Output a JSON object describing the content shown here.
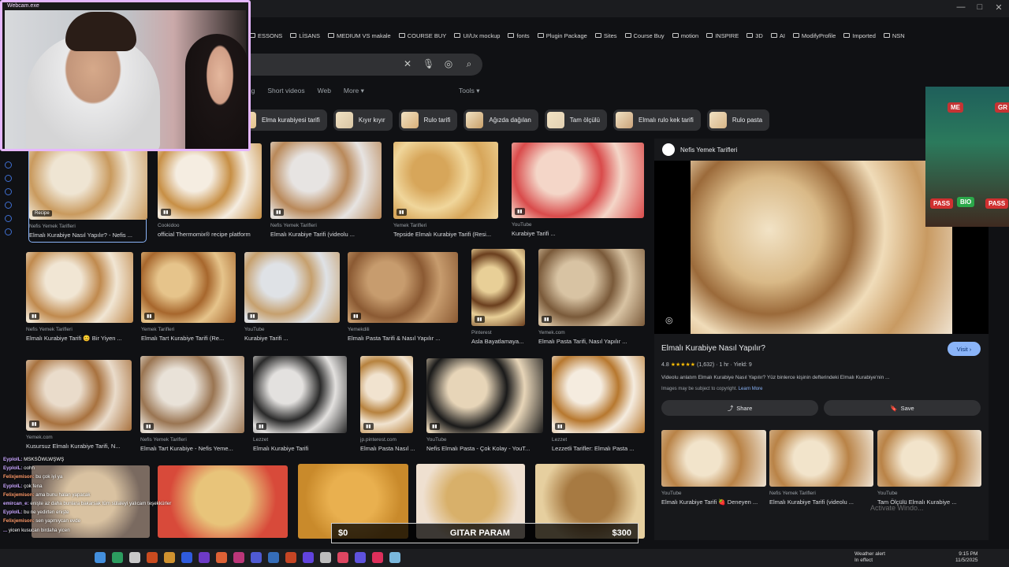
{
  "webcam": {
    "title": "Webcam.exe"
  },
  "window_controls": [
    "—",
    "□",
    "✕"
  ],
  "bookmarks": [
    "ESSONS",
    "LİSANS",
    "MEDIUM VS makale",
    "COURSE BUY",
    "UI/Ux mockup",
    "fonts",
    "Plugin Package",
    "Sites",
    "Course Buy",
    "motion",
    "INSPIRE",
    "3D",
    "AI",
    "ModifyProfile",
    "Imported",
    "NSN"
  ],
  "search": {
    "value": ""
  },
  "tabs": [
    "ing",
    "Short videos",
    "Web",
    "More"
  ],
  "tools_label": "Tools",
  "chips": [
    "Elma kurabiyesi tarifi",
    "Kıyır kıyır",
    "Rulo tarifi",
    "Ağızda dağılan",
    "Tam ölçülü",
    "Elmalı rulo kek tarifi",
    "Rulo pasta"
  ],
  "grid": [
    {
      "src": "Nefis Yemek Tarifleri",
      "title": "Elmalı Kurabiye Nasıl Yapılır? - Nefis ...",
      "badge": "Recipe"
    },
    {
      "src": "Cookidoo",
      "title": "official Thermomix® recipe platform",
      "badge": ""
    },
    {
      "src": "Nefis Yemek Tarifleri",
      "title": "Elmalı Kurabiye Tarifi (videolu ...",
      "badge": ""
    },
    {
      "src": "Yemek Tarifleri",
      "title": "Tepside Elmalı Kurabiye Tarifi (Resi...",
      "badge": ""
    },
    {
      "src": "YouTube",
      "title": "Kurabiye Tarifi ...",
      "badge": ""
    },
    {
      "src": "Nefis Yemek Tarifleri",
      "title": "Elmalı Kurabiye Tarifi 😊 Bir Yiyen ...",
      "badge": ""
    },
    {
      "src": "Yemek Tarifleri",
      "title": "Elmalı Tart Kurabiye Tarifi (Re...",
      "badge": ""
    },
    {
      "src": "YouTube",
      "title": "Kurabiye Tarifi ...",
      "badge": ""
    },
    {
      "src": "Yemekdili",
      "title": "Elmalı Pasta Tarifi & Nasıl Yapılır ...",
      "badge": ""
    },
    {
      "src": "Pinterest",
      "title": "Asla Bayatlamaya...",
      "badge": ""
    },
    {
      "src": "Yemek.com",
      "title": "Elmalı Pasta Tarifi, Nasıl Yapılır ...",
      "badge": ""
    },
    {
      "src": "Yemek.com",
      "title": "Kusursuz Elmalı Kurabiye Tarifi, N...",
      "badge": ""
    },
    {
      "src": "Nefis Yemek Tarifleri",
      "title": "Elmalı Tart Kurabiye - Nefis Yeme...",
      "badge": ""
    },
    {
      "src": "Lezzet",
      "title": "Elmalı Kurabiye Tarifi",
      "badge": ""
    },
    {
      "src": "jp.pinterest.com",
      "title": "Elmalı Pasta Nasıl ...",
      "badge": ""
    },
    {
      "src": "YouTube",
      "title": "Nefis Elmalı Pasta - Çok Kolay - YouT...",
      "badge": ""
    },
    {
      "src": "Lezzet",
      "title": "Lezzetli Tarifler: Elmalı Pasta ...",
      "badge": ""
    }
  ],
  "panel": {
    "source": "Nefis Yemek Tarifleri",
    "title": "Elmalı Kurabiye Nasıl Yapılır?",
    "visit_label": "Visit",
    "rating_value": "4.8",
    "stars": "★★★★★",
    "rating_count": "(1,632)",
    "time": "1 hr",
    "yield": "Yield: 9",
    "description": "Videolu anlatım Elmalı Kurabiye Nasıl Yapılır? Yüz binlerce kişinin defterindeki Elmalı Kurabiye'nin ...",
    "note": "Images may be subject to copyright.",
    "learn_more": "Learn More",
    "share_label": "Share",
    "save_label": "Save",
    "related": [
      {
        "src": "YouTube",
        "title": "Elmalı Kurabiye Tarifi 🍓 Deneyen ..."
      },
      {
        "src": "Nefis Yemek Tarifleri",
        "title": "Elmalı Kurabiye Tarifi (videolu ..."
      },
      {
        "src": "YouTube",
        "title": "Tam Ölçülü Elmalı Kurabiye ..."
      }
    ]
  },
  "game_tags": [
    "ME",
    "GR",
    "PASS",
    "BIO",
    "PASS"
  ],
  "chat": [
    {
      "user": "EyplolL:",
      "msg": "MSKSÖWLWŞWŞ"
    },
    {
      "user": "EyplolL:",
      "msg": "oohh"
    },
    {
      "user": "Felixjemison:",
      "msg": "bu çok iyi ya"
    },
    {
      "user": "EyplolL:",
      "msg": "çok fena"
    },
    {
      "user": "Felixjemison:",
      "msg": "ama bunu halan yapacak"
    },
    {
      "user": "emircan_e:",
      "msg": "enişte az daha bunlara bakarsak tüm sülaleyi yalıcam teşekkürler"
    },
    {
      "user": "EyplolL:",
      "msg": "bu ne yedirten enişte"
    },
    {
      "user": "Felixjemison:",
      "msg": "sen yapmıycan evde"
    },
    {
      "user": "...",
      "msg": "yicen kusucan birdaha yicen"
    }
  ],
  "money_bar": {
    "left": "$0",
    "center": "GITAR PARAM",
    "right": "$300"
  },
  "activate": "Activate Windo...",
  "weather": {
    "line1": "Weather alert",
    "line2": "In effect"
  },
  "clock": {
    "time": "9:15 PM",
    "date": "11/5/2025"
  },
  "colors": {
    "accent": "#8ab4f8",
    "webcam_border": "#e6b7ff",
    "chip_bg": "#303134"
  }
}
